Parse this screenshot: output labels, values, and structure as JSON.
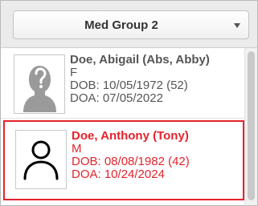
{
  "header": {
    "group_select": {
      "value": "Med Group 2"
    }
  },
  "patients": [
    {
      "name": "Doe, Abigail (Abs, Abby)",
      "sex": "F",
      "dob": "DOB: 10/05/1972 (52)",
      "doa": "DOA: 07/05/2022",
      "avatar_icon": "unknown-person-silhouette-icon",
      "selected": false
    },
    {
      "name": "Doe, Anthony (Tony)",
      "sex": "M",
      "dob": "DOB: 08/08/1982 (42)",
      "doa": "DOA: 10/24/2024",
      "avatar_icon": "person-outline-icon",
      "selected": true
    }
  ],
  "colors": {
    "selected_text": "#e4232c",
    "selected_border": "#e4232c",
    "normal_text": "#555555"
  }
}
